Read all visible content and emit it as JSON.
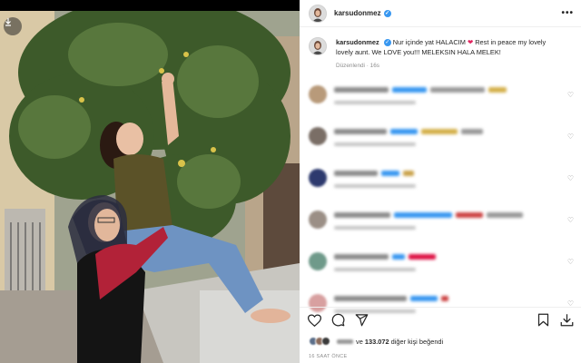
{
  "post": {
    "username": "karsudonmez",
    "verified_glyph": "✓",
    "more_glyph": "•••",
    "caption_text": "Nur içinde yat HALACIM",
    "caption_rest": "Rest in peace my lovely lovely aunt. We LOVE you!!! MELEKSIN HALA MELEK!",
    "caption_heart": "❤",
    "edited_label": "Düzenlendi",
    "edited_age": "16s",
    "likes_count": "133.072",
    "likes_text": "ve 133.072 diğer kişi beğendi",
    "likes_prefix": "ve",
    "likes_suffix": "diğer kişi beğendi",
    "posted_time": "16 SAAT ÖNCE"
  },
  "icons": {
    "download": "download-icon",
    "like": "heart-icon",
    "comment": "comment-icon",
    "share": "share-icon",
    "save": "bookmark-icon",
    "download_post": "download-icon"
  },
  "comments": [
    {
      "avatar_color": "#b89a7a",
      "bar_colors": [
        "#8c8c8c",
        "#3897f0",
        "#9a9a9a",
        "#d4b04a"
      ],
      "heart": "♡"
    },
    {
      "avatar_color": "#7a6e66",
      "bar_colors": [
        "#8c8c8c",
        "#3897f0",
        "#d4b04a",
        "#9a9a9a"
      ],
      "heart": "♡"
    },
    {
      "avatar_color": "#2d3a6e",
      "bar_colors": [
        "#8c8c8c",
        "#3897f0",
        "#c9a24a"
      ],
      "heart": "♡"
    },
    {
      "avatar_color": "#9b8f86",
      "bar_colors": [
        "#8c8c8c",
        "#3897f0",
        "#c44",
        "#9a9a9a"
      ],
      "heart": "♡"
    },
    {
      "avatar_color": "#6f9a8a",
      "bar_colors": [
        "#8c8c8c",
        "#3897f0",
        "#d14"
      ],
      "heart": "♡"
    },
    {
      "avatar_color": "#d8a0a0",
      "bar_colors": [
        "#8c8c8c",
        "#3897f0",
        "#c44"
      ],
      "heart": "♡"
    }
  ],
  "colors": {
    "accent_blue": "#3897f0",
    "heart_red": "#e0245e",
    "muted_text": "#8e8e8e"
  }
}
